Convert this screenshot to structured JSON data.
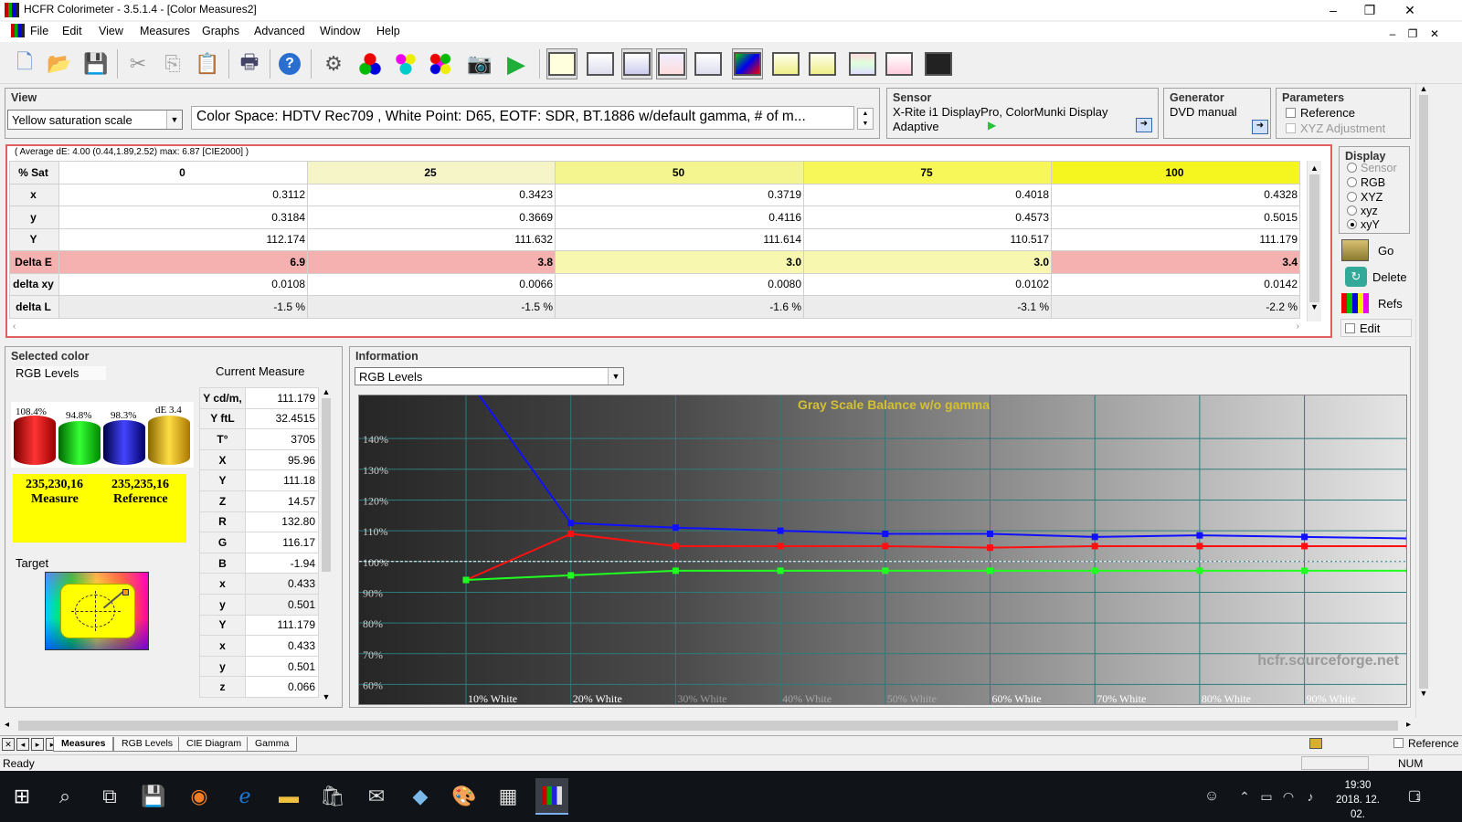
{
  "window": {
    "title": "HCFR Colorimeter - 3.5.1.4 - [Color Measures2]",
    "controls": {
      "minimize": "–",
      "restore": "❐",
      "close": "✕"
    }
  },
  "menu": [
    "File",
    "Edit",
    "View",
    "Measures",
    "Graphs",
    "Advanced",
    "Window",
    "Help"
  ],
  "view": {
    "title": "View",
    "scale_select": "Yellow saturation scale",
    "info_text": "Color Space: HDTV Rec709 , White Point: D65, EOTF:  SDR, BT.1886 w/default gamma, # of m..."
  },
  "sensor": {
    "title": "Sensor",
    "device": "X-Rite i1 DisplayPro, ColorMunki Display",
    "mode": "Adaptive"
  },
  "generator": {
    "title": "Generator",
    "value": "DVD manual"
  },
  "parameters": {
    "title": "Parameters",
    "reference": "Reference",
    "xyz_adjustment": "XYZ Adjustment"
  },
  "measure_table": {
    "summary": "( Average dE: 4.00 (0.44,1.89,2.52) max: 6.87 [CIE2000] )",
    "corner": "% Sat",
    "columns": [
      "0",
      "25",
      "50",
      "75",
      "100"
    ],
    "rows": [
      {
        "label": "x",
        "values": [
          "0.3112",
          "0.3423",
          "0.3719",
          "0.4018",
          "0.4328"
        ]
      },
      {
        "label": "y",
        "values": [
          "0.3184",
          "0.3669",
          "0.4116",
          "0.4573",
          "0.5015"
        ]
      },
      {
        "label": "Y",
        "values": [
          "112.174",
          "111.632",
          "111.614",
          "110.517",
          "111.179"
        ]
      },
      {
        "label": "Delta E",
        "values": [
          "6.9",
          "3.8",
          "3.0",
          "3.0",
          "3.4"
        ]
      },
      {
        "label": "delta xy",
        "values": [
          "0.0108",
          "0.0066",
          "0.0080",
          "0.0102",
          "0.0142"
        ]
      },
      {
        "label": "delta L",
        "values": [
          "-1.5 %",
          "-1.5 %",
          "-1.6 %",
          "-3.1 %",
          "-2.2 %"
        ]
      }
    ],
    "colors": {
      "col_bg": [
        "#ffffff",
        "#f5f5c8",
        "#f5f590",
        "#f7f75a",
        "#f5f520"
      ],
      "de_bad": "#f5b0b0",
      "de_ok": "#f7f7b0"
    }
  },
  "display_panel": {
    "title": "Display",
    "options": [
      "Sensor",
      "RGB",
      "XYZ",
      "xyz",
      "xyY"
    ],
    "selected": "xyY",
    "buttons": {
      "go": "Go",
      "delete": "Delete",
      "refs": "Refs",
      "edit": "Edit"
    }
  },
  "selected_color": {
    "title": "Selected color",
    "rgb_levels_label": "RGB Levels",
    "bars": [
      {
        "label": "108.4%",
        "color": "#e00000"
      },
      {
        "label": "94.8%",
        "color": "#00c000"
      },
      {
        "label": "98.3%",
        "color": "#1020e0"
      },
      {
        "label": "dE 3.4",
        "color": "#e8c000"
      }
    ],
    "measure_rgb": "235,230,16",
    "measure_label": "Measure",
    "reference_rgb": "235,235,16",
    "reference_label": "Reference",
    "target_label": "Target"
  },
  "current_measure": {
    "title": "Current Measure",
    "rows": [
      {
        "label": "Y cd/m,",
        "value": "111.179"
      },
      {
        "label": "Y ftL",
        "value": "32.4515"
      },
      {
        "label": "T°",
        "value": "3705"
      },
      {
        "label": "X",
        "value": "95.96"
      },
      {
        "label": "Y",
        "value": "111.18"
      },
      {
        "label": "Z",
        "value": "14.57"
      },
      {
        "label": "R",
        "value": "132.80"
      },
      {
        "label": "G",
        "value": "116.17"
      },
      {
        "label": "B",
        "value": "-1.94"
      },
      {
        "label": "x",
        "value": "0.433"
      },
      {
        "label": "y",
        "value": "0.501"
      },
      {
        "label": "Y",
        "value": "111.179"
      },
      {
        "label": "x",
        "value": "0.433"
      },
      {
        "label": "y",
        "value": "0.501"
      },
      {
        "label": "z",
        "value": "0.066"
      }
    ]
  },
  "information": {
    "title": "Information",
    "select": "RGB Levels",
    "watermark": "hcfr.sourceforge.net"
  },
  "chart_data": {
    "type": "line",
    "title": "Gray Scale Balance w/o gamma",
    "x": [
      "10% White",
      "20% White",
      "30% White",
      "40% White",
      "50% White",
      "60% White",
      "70% White",
      "80% White",
      "90% White"
    ],
    "yticks": [
      "140%",
      "130%",
      "120%",
      "110%",
      "100%",
      "90%",
      "80%",
      "70%",
      "60%"
    ],
    "ylim": [
      53,
      154
    ],
    "reference_line": 100,
    "series": [
      {
        "color": "#ff1010",
        "values": [
          94,
          109,
          105,
          105,
          105,
          104.5,
          105,
          105,
          105,
          105
        ]
      },
      {
        "color": "#20ff20",
        "values": [
          94,
          95.5,
          97,
          97,
          97,
          97,
          97,
          97,
          97,
          97
        ]
      },
      {
        "color": "#1010ff",
        "values": [
          160,
          112.5,
          111,
          110,
          109,
          109,
          108,
          108.5,
          108,
          107.5
        ]
      }
    ]
  },
  "tabs": {
    "nav": [
      "✕",
      "◂",
      "▸",
      "▸"
    ],
    "items": [
      "Measures",
      "RGB Levels",
      "CIE Diagram",
      "Gamma"
    ],
    "active": "Measures",
    "reference": "Reference"
  },
  "status": {
    "text": "Ready",
    "num": "NUM"
  },
  "taskbar": {
    "time": "19:30",
    "date": "2018. 12. 02.",
    "notifications": "1"
  }
}
